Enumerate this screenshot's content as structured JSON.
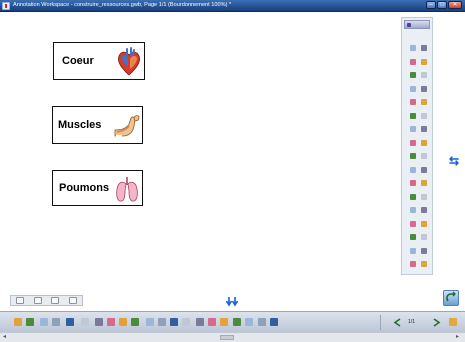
{
  "window": {
    "title": "Annotation Workspace - construire_ressources.gwb, Page 1/1  (Bourdonnement 100%) *",
    "buttons": {
      "minimize": "–",
      "maximize": "□",
      "close": "✕"
    }
  },
  "cards": [
    {
      "label": "Coeur",
      "icon": "heart-icon"
    },
    {
      "label": "Muscles",
      "icon": "muscle-arm-icon"
    },
    {
      "label": "Poumons",
      "icon": "lungs-icon"
    }
  ],
  "bottom_toolbar": {
    "page_indicator": "1/1"
  },
  "side_toggle_glyph": "⇆",
  "status_bar": {
    "left_arrow": "◂",
    "right_arrow": "▸"
  },
  "colors": {
    "titlebar": "#1f4c94",
    "accent": "#1a5fd6",
    "close": "#c7412b"
  }
}
